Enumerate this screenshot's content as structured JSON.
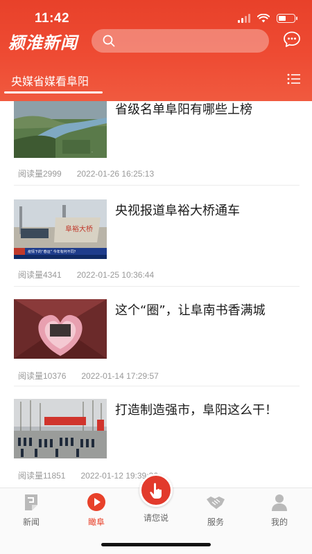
{
  "status_bar": {
    "time": "11:42"
  },
  "header": {
    "app_title": "颍淮新闻",
    "search_placeholder": "",
    "active_tab": "央媒省媒看阜阳"
  },
  "articles": [
    {
      "title": "省级名单阜阳有哪些上榜",
      "reads": "阅读量2999",
      "date": "2022-01-26  16:25:13",
      "image": "river-aerial"
    },
    {
      "title": "央视报道阜裕大桥通车",
      "reads": "阅读量4341",
      "date": "2022-01-25  10:36:44",
      "image": "news-broadcast"
    },
    {
      "title": "这个“圈”，让阜南书香满城",
      "reads": "阅读量10376",
      "date": "2022-01-14  17:29:57",
      "image": "bookstore"
    },
    {
      "title": "打造制造强市，阜阳这么干！",
      "reads": "阅读量11851",
      "date": "2022-01-12  19:39:36",
      "image": "ceremony"
    }
  ],
  "bottom_nav": {
    "items": [
      {
        "label": "新闻",
        "icon": "news-icon"
      },
      {
        "label": "瞰阜",
        "icon": "play-icon"
      },
      {
        "label": "请您说",
        "icon": "hand-tap-icon"
      },
      {
        "label": "服务",
        "icon": "handshake-icon"
      },
      {
        "label": "我的",
        "icon": "person-icon"
      }
    ],
    "active": "瞰阜"
  },
  "colors": {
    "brand": "#e8412a",
    "active_tab": "#e8412a",
    "text": "#1a1a1a",
    "meta": "#999999"
  }
}
